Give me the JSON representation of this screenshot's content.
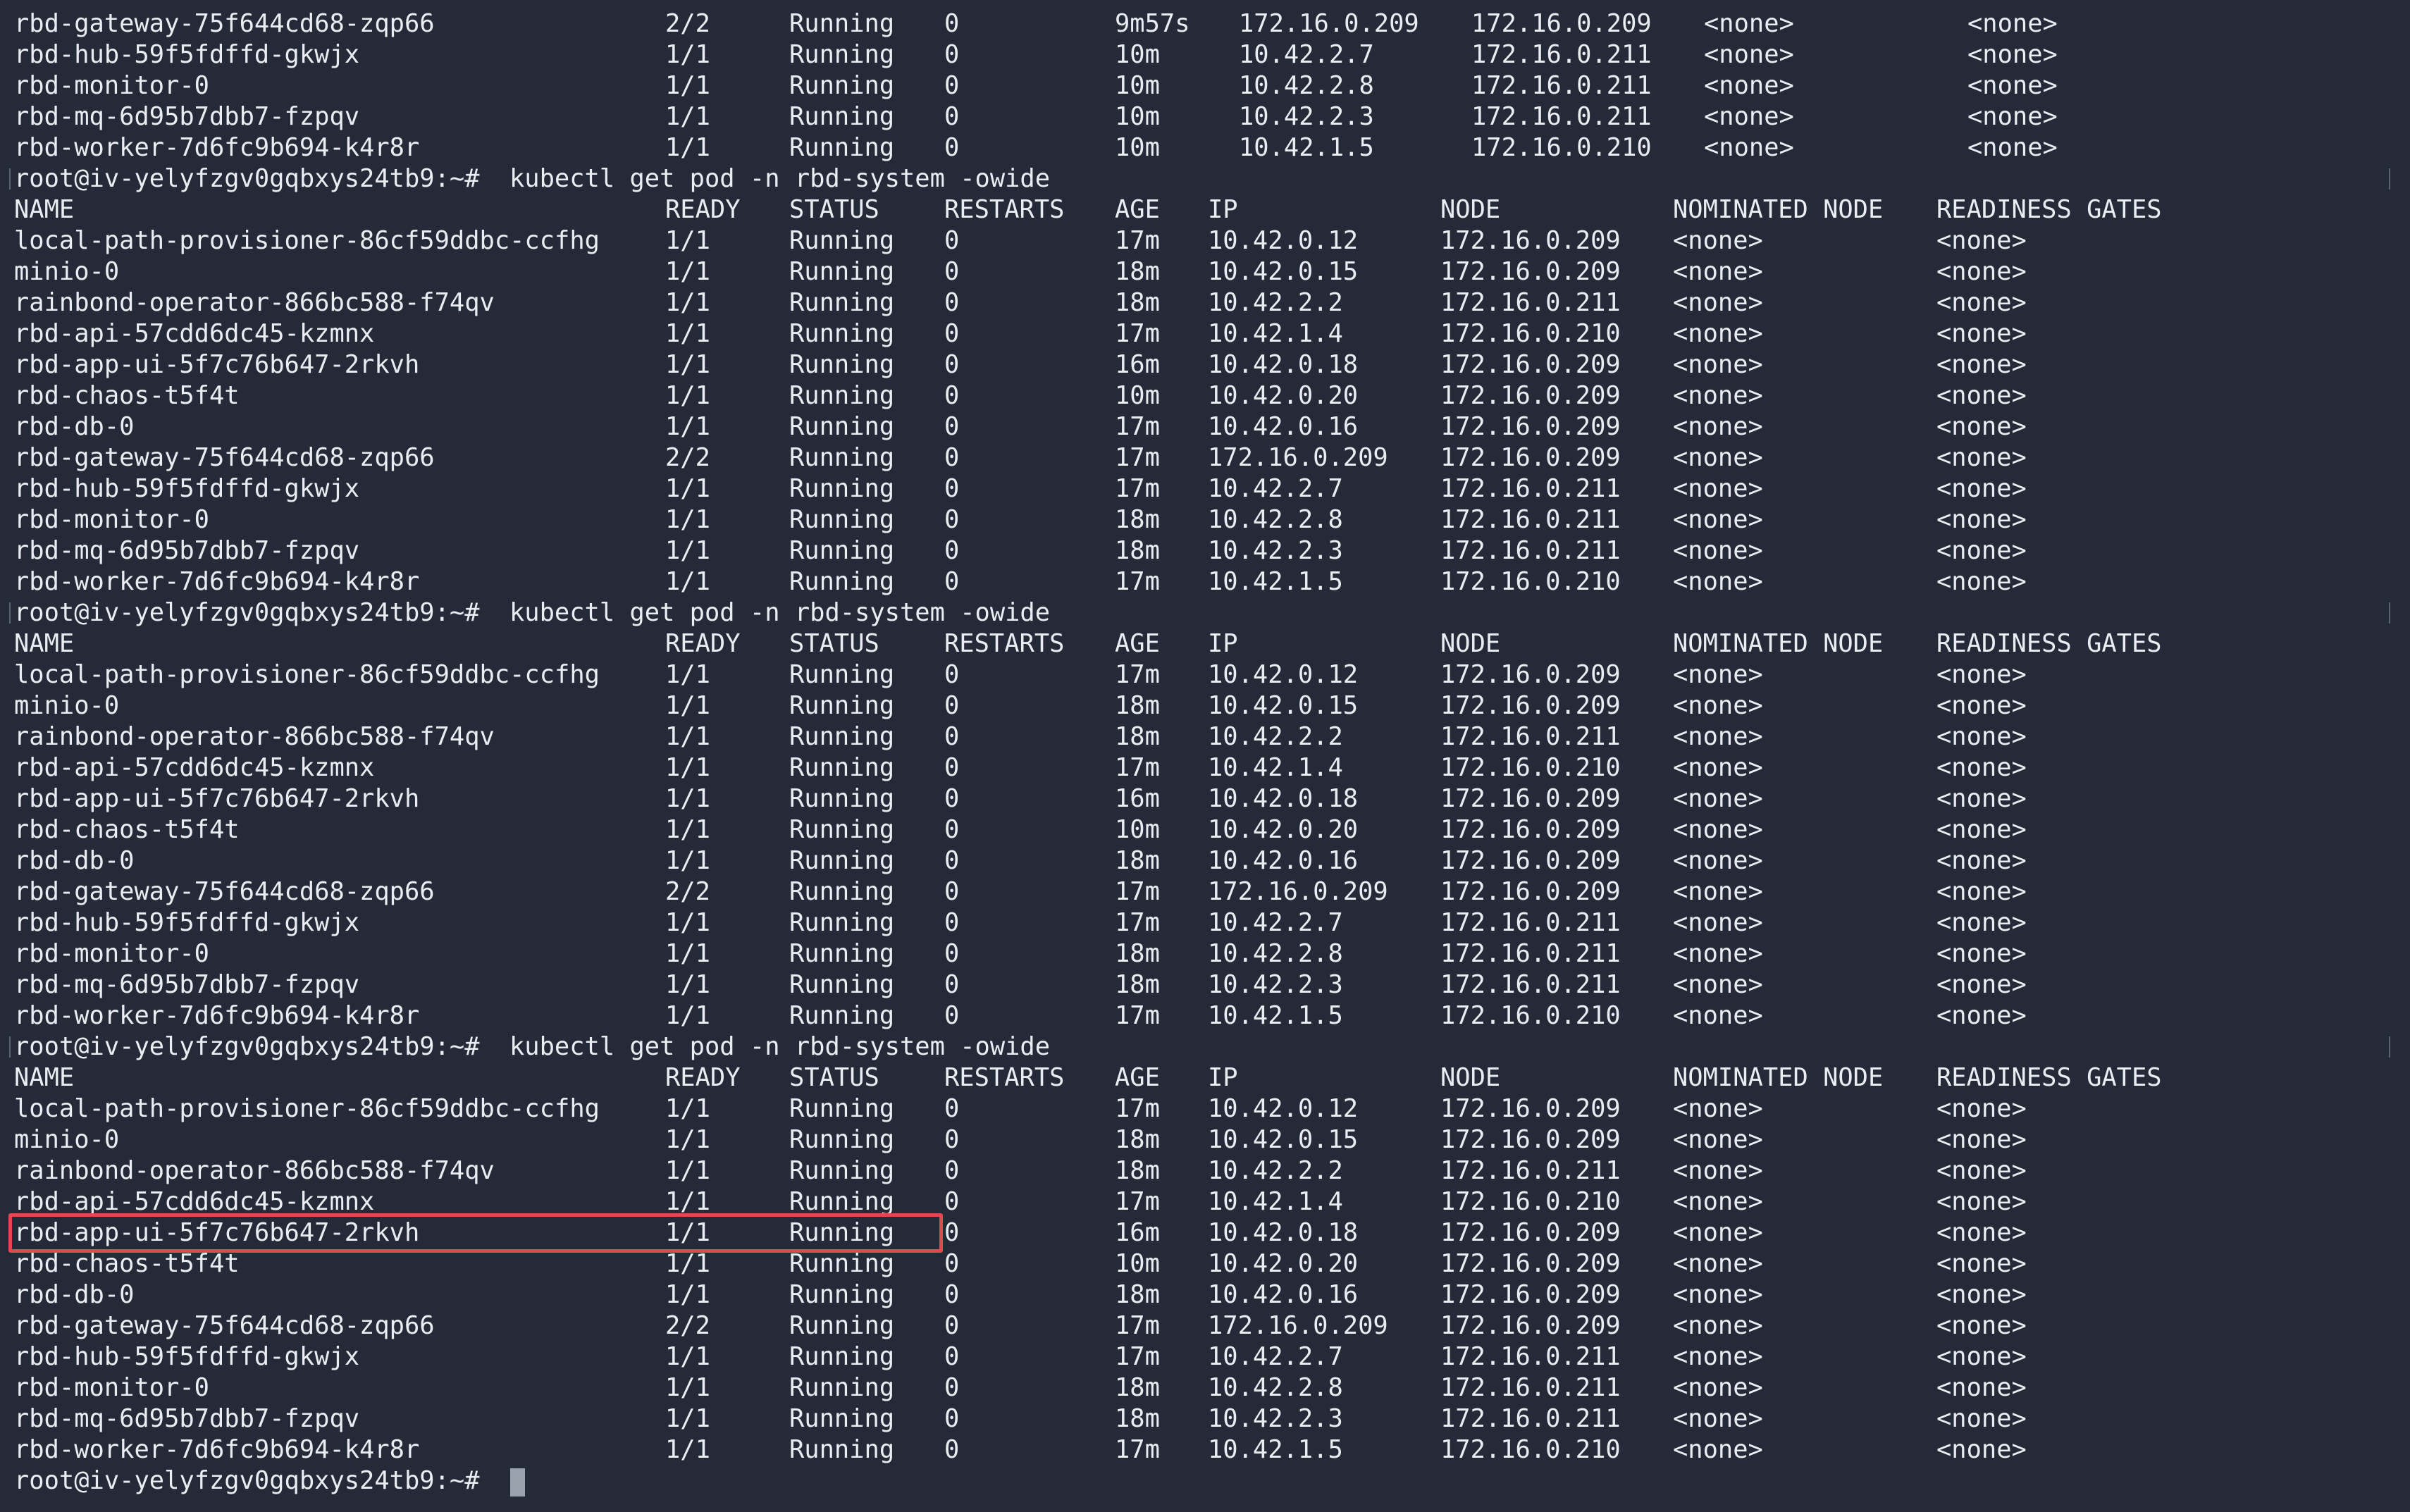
{
  "terminal": {
    "prompt": "root@iv-yelyfzgv0gqbxys24tb9:~#",
    "command": "kubectl get pod -n rbd-system -owide",
    "headers": [
      "NAME",
      "READY",
      "STATUS",
      "RESTARTS",
      "AGE",
      "IP",
      "NODE",
      "NOMINATED NODE",
      "READINESS GATES"
    ],
    "top_partial_rows": [
      [
        "rbd-gateway-75f644cd68-zqp66",
        "2/2",
        "Running",
        "0",
        "9m57s",
        "172.16.0.209",
        "172.16.0.209",
        "<none>",
        "<none>"
      ],
      [
        "rbd-hub-59f5fdffd-gkwjx",
        "1/1",
        "Running",
        "0",
        "10m",
        "10.42.2.7",
        "172.16.0.211",
        "<none>",
        "<none>"
      ],
      [
        "rbd-monitor-0",
        "1/1",
        "Running",
        "0",
        "10m",
        "10.42.2.8",
        "172.16.0.211",
        "<none>",
        "<none>"
      ],
      [
        "rbd-mq-6d95b7dbb7-fzpqv",
        "1/1",
        "Running",
        "0",
        "10m",
        "10.42.2.3",
        "172.16.0.211",
        "<none>",
        "<none>"
      ],
      [
        "rbd-worker-7d6fc9b694-k4r8r",
        "1/1",
        "Running",
        "0",
        "10m",
        "10.42.1.5",
        "172.16.0.210",
        "<none>",
        "<none>"
      ]
    ],
    "blocks": [
      {
        "rows": [
          [
            "local-path-provisioner-86cf59ddbc-ccfhg",
            "1/1",
            "Running",
            "0",
            "17m",
            "10.42.0.12",
            "172.16.0.209",
            "<none>",
            "<none>"
          ],
          [
            "minio-0",
            "1/1",
            "Running",
            "0",
            "18m",
            "10.42.0.15",
            "172.16.0.209",
            "<none>",
            "<none>"
          ],
          [
            "rainbond-operator-866bc588-f74qv",
            "1/1",
            "Running",
            "0",
            "18m",
            "10.42.2.2",
            "172.16.0.211",
            "<none>",
            "<none>"
          ],
          [
            "rbd-api-57cdd6dc45-kzmnx",
            "1/1",
            "Running",
            "0",
            "17m",
            "10.42.1.4",
            "172.16.0.210",
            "<none>",
            "<none>"
          ],
          [
            "rbd-app-ui-5f7c76b647-2rkvh",
            "1/1",
            "Running",
            "0",
            "16m",
            "10.42.0.18",
            "172.16.0.209",
            "<none>",
            "<none>"
          ],
          [
            "rbd-chaos-t5f4t",
            "1/1",
            "Running",
            "0",
            "10m",
            "10.42.0.20",
            "172.16.0.209",
            "<none>",
            "<none>"
          ],
          [
            "rbd-db-0",
            "1/1",
            "Running",
            "0",
            "17m",
            "10.42.0.16",
            "172.16.0.209",
            "<none>",
            "<none>"
          ],
          [
            "rbd-gateway-75f644cd68-zqp66",
            "2/2",
            "Running",
            "0",
            "17m",
            "172.16.0.209",
            "172.16.0.209",
            "<none>",
            "<none>"
          ],
          [
            "rbd-hub-59f5fdffd-gkwjx",
            "1/1",
            "Running",
            "0",
            "17m",
            "10.42.2.7",
            "172.16.0.211",
            "<none>",
            "<none>"
          ],
          [
            "rbd-monitor-0",
            "1/1",
            "Running",
            "0",
            "18m",
            "10.42.2.8",
            "172.16.0.211",
            "<none>",
            "<none>"
          ],
          [
            "rbd-mq-6d95b7dbb7-fzpqv",
            "1/1",
            "Running",
            "0",
            "18m",
            "10.42.2.3",
            "172.16.0.211",
            "<none>",
            "<none>"
          ],
          [
            "rbd-worker-7d6fc9b694-k4r8r",
            "1/1",
            "Running",
            "0",
            "17m",
            "10.42.1.5",
            "172.16.0.210",
            "<none>",
            "<none>"
          ]
        ]
      },
      {
        "rows": [
          [
            "local-path-provisioner-86cf59ddbc-ccfhg",
            "1/1",
            "Running",
            "0",
            "17m",
            "10.42.0.12",
            "172.16.0.209",
            "<none>",
            "<none>"
          ],
          [
            "minio-0",
            "1/1",
            "Running",
            "0",
            "18m",
            "10.42.0.15",
            "172.16.0.209",
            "<none>",
            "<none>"
          ],
          [
            "rainbond-operator-866bc588-f74qv",
            "1/1",
            "Running",
            "0",
            "18m",
            "10.42.2.2",
            "172.16.0.211",
            "<none>",
            "<none>"
          ],
          [
            "rbd-api-57cdd6dc45-kzmnx",
            "1/1",
            "Running",
            "0",
            "17m",
            "10.42.1.4",
            "172.16.0.210",
            "<none>",
            "<none>"
          ],
          [
            "rbd-app-ui-5f7c76b647-2rkvh",
            "1/1",
            "Running",
            "0",
            "16m",
            "10.42.0.18",
            "172.16.0.209",
            "<none>",
            "<none>"
          ],
          [
            "rbd-chaos-t5f4t",
            "1/1",
            "Running",
            "0",
            "10m",
            "10.42.0.20",
            "172.16.0.209",
            "<none>",
            "<none>"
          ],
          [
            "rbd-db-0",
            "1/1",
            "Running",
            "0",
            "18m",
            "10.42.0.16",
            "172.16.0.209",
            "<none>",
            "<none>"
          ],
          [
            "rbd-gateway-75f644cd68-zqp66",
            "2/2",
            "Running",
            "0",
            "17m",
            "172.16.0.209",
            "172.16.0.209",
            "<none>",
            "<none>"
          ],
          [
            "rbd-hub-59f5fdffd-gkwjx",
            "1/1",
            "Running",
            "0",
            "17m",
            "10.42.2.7",
            "172.16.0.211",
            "<none>",
            "<none>"
          ],
          [
            "rbd-monitor-0",
            "1/1",
            "Running",
            "0",
            "18m",
            "10.42.2.8",
            "172.16.0.211",
            "<none>",
            "<none>"
          ],
          [
            "rbd-mq-6d95b7dbb7-fzpqv",
            "1/1",
            "Running",
            "0",
            "18m",
            "10.42.2.3",
            "172.16.0.211",
            "<none>",
            "<none>"
          ],
          [
            "rbd-worker-7d6fc9b694-k4r8r",
            "1/1",
            "Running",
            "0",
            "17m",
            "10.42.1.5",
            "172.16.0.210",
            "<none>",
            "<none>"
          ]
        ]
      },
      {
        "rows": [
          [
            "local-path-provisioner-86cf59ddbc-ccfhg",
            "1/1",
            "Running",
            "0",
            "17m",
            "10.42.0.12",
            "172.16.0.209",
            "<none>",
            "<none>"
          ],
          [
            "minio-0",
            "1/1",
            "Running",
            "0",
            "18m",
            "10.42.0.15",
            "172.16.0.209",
            "<none>",
            "<none>"
          ],
          [
            "rainbond-operator-866bc588-f74qv",
            "1/1",
            "Running",
            "0",
            "18m",
            "10.42.2.2",
            "172.16.0.211",
            "<none>",
            "<none>"
          ],
          [
            "rbd-api-57cdd6dc45-kzmnx",
            "1/1",
            "Running",
            "0",
            "17m",
            "10.42.1.4",
            "172.16.0.210",
            "<none>",
            "<none>"
          ],
          [
            "rbd-app-ui-5f7c76b647-2rkvh",
            "1/1",
            "Running",
            "0",
            "16m",
            "10.42.0.18",
            "172.16.0.209",
            "<none>",
            "<none>"
          ],
          [
            "rbd-chaos-t5f4t",
            "1/1",
            "Running",
            "0",
            "10m",
            "10.42.0.20",
            "172.16.0.209",
            "<none>",
            "<none>"
          ],
          [
            "rbd-db-0",
            "1/1",
            "Running",
            "0",
            "18m",
            "10.42.0.16",
            "172.16.0.209",
            "<none>",
            "<none>"
          ],
          [
            "rbd-gateway-75f644cd68-zqp66",
            "2/2",
            "Running",
            "0",
            "17m",
            "172.16.0.209",
            "172.16.0.209",
            "<none>",
            "<none>"
          ],
          [
            "rbd-hub-59f5fdffd-gkwjx",
            "1/1",
            "Running",
            "0",
            "17m",
            "10.42.2.7",
            "172.16.0.211",
            "<none>",
            "<none>"
          ],
          [
            "rbd-monitor-0",
            "1/1",
            "Running",
            "0",
            "18m",
            "10.42.2.8",
            "172.16.0.211",
            "<none>",
            "<none>"
          ],
          [
            "rbd-mq-6d95b7dbb7-fzpqv",
            "1/1",
            "Running",
            "0",
            "18m",
            "10.42.2.3",
            "172.16.0.211",
            "<none>",
            "<none>"
          ],
          [
            "rbd-worker-7d6fc9b694-k4r8r",
            "1/1",
            "Running",
            "0",
            "17m",
            "10.42.1.5",
            "172.16.0.210",
            "<none>",
            "<none>"
          ]
        ]
      }
    ],
    "highlighted_row": {
      "block": 2,
      "row": 4
    },
    "colors": {
      "background": "#242a37",
      "text": "#e9edf2",
      "highlight": "#e4474f",
      "cursor": "#9aa3ad"
    }
  }
}
